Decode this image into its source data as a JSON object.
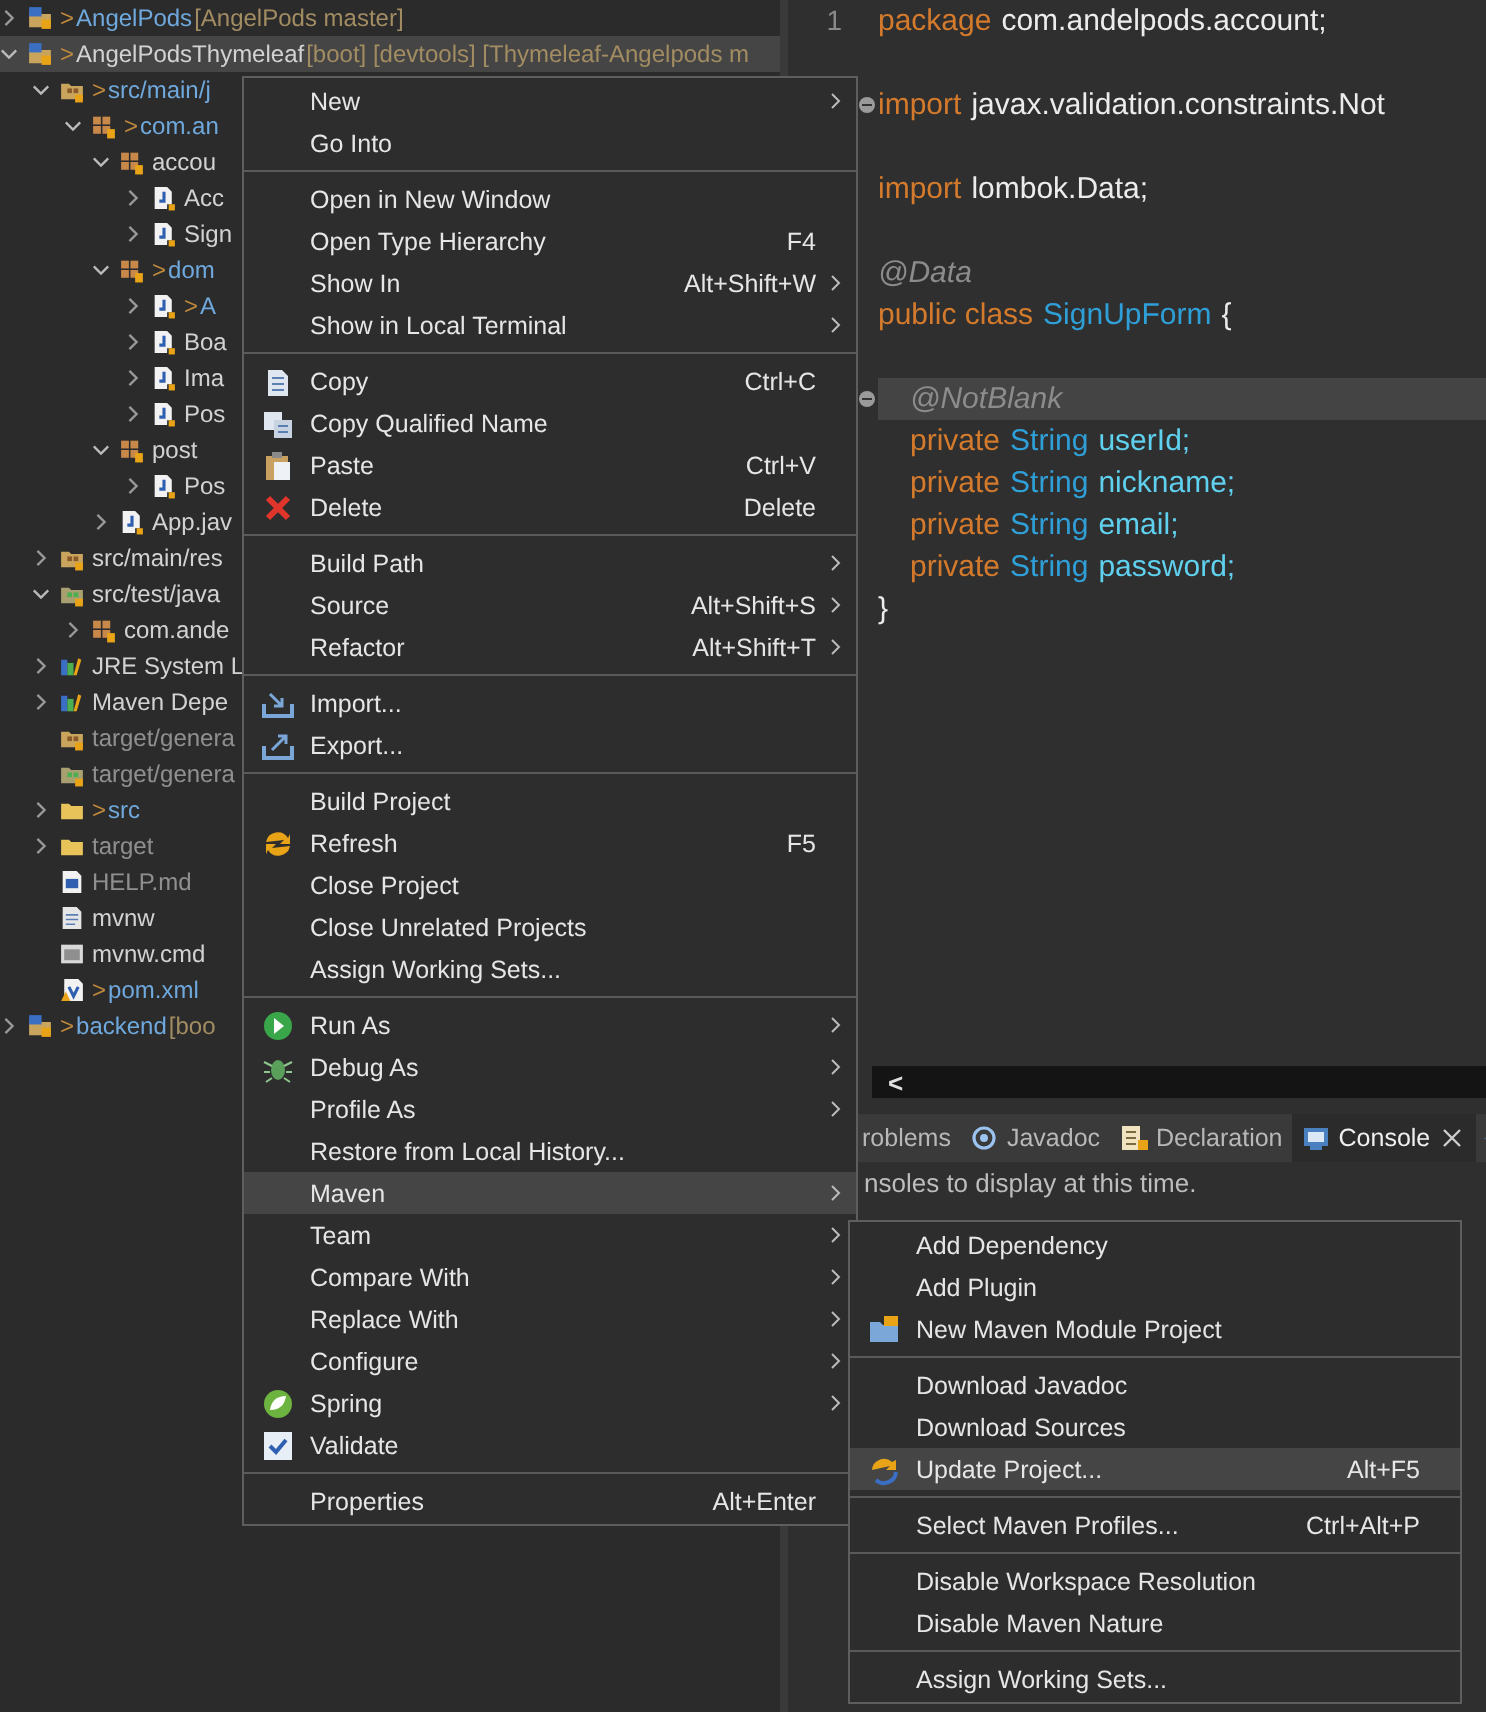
{
  "explorer": {
    "tree": [
      {
        "label": "AngelPods",
        "marker": ">",
        "deco": "[AngelPods master]",
        "kind": "project",
        "changed": true,
        "derived": false,
        "expandable": true,
        "expanded": false,
        "selected": false
      },
      {
        "label": "AngelPodsThymeleaf",
        "marker": ">",
        "deco": "[boot] [devtools] [Thymeleaf-Angelpods m",
        "kind": "project",
        "changed": false,
        "derived": false,
        "expandable": true,
        "expanded": true,
        "selected": true,
        "children": [
          {
            "label": "src/main/j",
            "marker": ">",
            "kind": "srcfolder",
            "changed": true,
            "derived": false,
            "expandable": true,
            "expanded": true,
            "selected": false,
            "children": [
              {
                "label": "com.an",
                "marker": ">",
                "kind": "package",
                "changed": true,
                "derived": false,
                "expandable": true,
                "expanded": true,
                "selected": false,
                "children": [
                  {
                    "label": "accou",
                    "kind": "package",
                    "changed": false,
                    "derived": false,
                    "expandable": true,
                    "expanded": true,
                    "selected": false,
                    "children": [
                      {
                        "label": "Acc",
                        "kind": "java",
                        "changed": false,
                        "derived": false,
                        "expandable": true,
                        "expanded": false,
                        "selected": false
                      },
                      {
                        "label": "Sign",
                        "kind": "java",
                        "changed": false,
                        "derived": false,
                        "expandable": true,
                        "expanded": false,
                        "selected": false
                      }
                    ]
                  },
                  {
                    "label": "dom",
                    "marker": ">",
                    "kind": "package",
                    "changed": true,
                    "derived": false,
                    "expandable": true,
                    "expanded": true,
                    "selected": false,
                    "children": [
                      {
                        "label": "A",
                        "marker": ">",
                        "kind": "java",
                        "changed": true,
                        "derived": false,
                        "expandable": true,
                        "expanded": false,
                        "selected": false
                      },
                      {
                        "label": "Boa",
                        "kind": "java",
                        "changed": false,
                        "derived": false,
                        "expandable": true,
                        "expanded": false,
                        "selected": false
                      },
                      {
                        "label": "Ima",
                        "kind": "java",
                        "changed": false,
                        "derived": false,
                        "expandable": true,
                        "expanded": false,
                        "selected": false
                      },
                      {
                        "label": "Pos",
                        "kind": "java",
                        "changed": false,
                        "derived": false,
                        "expandable": true,
                        "expanded": false,
                        "selected": false
                      }
                    ]
                  },
                  {
                    "label": "post",
                    "kind": "package",
                    "changed": false,
                    "derived": false,
                    "expandable": true,
                    "expanded": true,
                    "selected": false,
                    "children": [
                      {
                        "label": "Pos",
                        "kind": "java",
                        "changed": false,
                        "derived": false,
                        "expandable": true,
                        "expanded": false,
                        "selected": false
                      }
                    ]
                  },
                  {
                    "label": "App.jav",
                    "kind": "java",
                    "changed": false,
                    "derived": false,
                    "expandable": true,
                    "expanded": false,
                    "selected": false
                  }
                ]
              }
            ]
          },
          {
            "label": "src/main/res",
            "kind": "srcfolder",
            "changed": false,
            "derived": false,
            "expandable": true,
            "expanded": false,
            "selected": false
          },
          {
            "label": "src/test/java",
            "kind": "testfolder",
            "changed": false,
            "derived": false,
            "expandable": true,
            "expanded": true,
            "selected": false,
            "children": [
              {
                "label": "com.ande",
                "kind": "package",
                "changed": false,
                "derived": false,
                "expandable": true,
                "expanded": false,
                "selected": false
              }
            ]
          },
          {
            "label": "JRE System L",
            "kind": "library",
            "changed": false,
            "derived": false,
            "expandable": true,
            "expanded": false,
            "selected": false
          },
          {
            "label": "Maven Depe",
            "kind": "library",
            "changed": false,
            "derived": false,
            "expandable": true,
            "expanded": false,
            "selected": false
          },
          {
            "label": "target/genera",
            "kind": "srcfolder",
            "changed": false,
            "derived": true,
            "expandable": false,
            "selected": false
          },
          {
            "label": "target/genera",
            "kind": "testfolder",
            "changed": false,
            "derived": true,
            "expandable": false,
            "selected": false
          },
          {
            "label": "src",
            "marker": ">",
            "kind": "folder",
            "changed": true,
            "derived": false,
            "expandable": true,
            "expanded": false,
            "selected": false
          },
          {
            "label": "target",
            "kind": "folder",
            "changed": false,
            "derived": true,
            "expandable": true,
            "expanded": false,
            "selected": false
          },
          {
            "label": "HELP.md",
            "kind": "doc",
            "changed": false,
            "derived": true,
            "expandable": false,
            "selected": false
          },
          {
            "label": "mvnw",
            "kind": "text",
            "changed": false,
            "derived": false,
            "expandable": false,
            "selected": false
          },
          {
            "label": "mvnw.cmd",
            "kind": "cmd",
            "changed": false,
            "derived": false,
            "expandable": false,
            "selected": false
          },
          {
            "label": "pom.xml",
            "marker": ">",
            "kind": "xml",
            "changed": true,
            "derived": false,
            "expandable": false,
            "selected": false
          }
        ]
      },
      {
        "label": "backend",
        "marker": ">",
        "deco": "[boo",
        "kind": "project",
        "changed": true,
        "derived": false,
        "expandable": true,
        "expanded": false,
        "selected": false
      }
    ]
  },
  "editor": {
    "line_numbers": [
      "1"
    ],
    "lines": [
      {
        "kind": "code",
        "indented": false,
        "current": false,
        "fold": false,
        "tokens": [
          {
            "kind": "keyword",
            "text": "package"
          },
          {
            "kind": "plain",
            "text": "com.andelpods.account;"
          }
        ]
      },
      {
        "kind": "blank"
      },
      {
        "kind": "code",
        "indented": false,
        "current": false,
        "fold": true,
        "tokens": [
          {
            "kind": "keyword",
            "text": "import"
          },
          {
            "kind": "plain",
            "text": "javax.validation.constraints.Not"
          }
        ]
      },
      {
        "kind": "blank"
      },
      {
        "kind": "code",
        "indented": false,
        "current": false,
        "fold": false,
        "tokens": [
          {
            "kind": "keyword",
            "text": "import"
          },
          {
            "kind": "plain",
            "text": "lombok.Data;"
          }
        ]
      },
      {
        "kind": "blank"
      },
      {
        "kind": "code",
        "indented": false,
        "current": false,
        "fold": false,
        "tokens": [
          {
            "kind": "annotation",
            "text": "@Data"
          }
        ]
      },
      {
        "kind": "code",
        "indented": false,
        "current": false,
        "fold": false,
        "tokens": [
          {
            "kind": "keyword",
            "text": "public class"
          },
          {
            "kind": "type",
            "text": "SignUpForm"
          },
          {
            "kind": "plain",
            "text": "{"
          }
        ]
      },
      {
        "kind": "blank"
      },
      {
        "kind": "code",
        "indented": true,
        "current": true,
        "fold": true,
        "tokens": [
          {
            "kind": "annotation",
            "text": "@NotBlank"
          }
        ]
      },
      {
        "kind": "code",
        "indented": true,
        "current": false,
        "fold": false,
        "tokens": [
          {
            "kind": "keyword",
            "text": "private"
          },
          {
            "kind": "type",
            "text": "String"
          },
          {
            "kind": "field",
            "text": "userId;"
          }
        ]
      },
      {
        "kind": "code",
        "indented": true,
        "current": false,
        "fold": false,
        "tokens": [
          {
            "kind": "keyword",
            "text": "private"
          },
          {
            "kind": "type",
            "text": "String"
          },
          {
            "kind": "field",
            "text": "nickname;"
          }
        ]
      },
      {
        "kind": "code",
        "indented": true,
        "current": false,
        "fold": false,
        "tokens": [
          {
            "kind": "keyword",
            "text": "private"
          },
          {
            "kind": "type",
            "text": "String"
          },
          {
            "kind": "field",
            "text": "email;"
          }
        ]
      },
      {
        "kind": "code",
        "indented": true,
        "current": false,
        "fold": false,
        "tokens": [
          {
            "kind": "keyword",
            "text": "private"
          },
          {
            "kind": "type",
            "text": "String"
          },
          {
            "kind": "field",
            "text": "password;"
          }
        ]
      },
      {
        "kind": "code",
        "indented": false,
        "current": false,
        "fold": false,
        "tokens": [
          {
            "kind": "plain",
            "text": "}"
          }
        ]
      }
    ],
    "scroll_arrow": "<"
  },
  "bottom_panel": {
    "tabs": [
      {
        "label": "roblems",
        "kind": "plain",
        "selected": false,
        "closable": false
      },
      {
        "label": "Javadoc",
        "kind": "javadoc",
        "selected": false,
        "closable": false
      },
      {
        "label": "Declaration",
        "kind": "declaration",
        "selected": false,
        "closable": false
      },
      {
        "label": "Console",
        "kind": "console",
        "selected": true,
        "closable": true
      }
    ],
    "message": "nsoles to display at this time."
  },
  "context_menu": {
    "items": [
      {
        "kind": "plain",
        "label": "New",
        "submenu": true,
        "selected": false
      },
      {
        "kind": "plain",
        "label": "Go Into",
        "submenu": false,
        "selected": false
      },
      {
        "kind": "separator"
      },
      {
        "kind": "plain",
        "label": "Open in New Window",
        "submenu": false,
        "selected": false
      },
      {
        "kind": "plain",
        "label": "Open Type Hierarchy",
        "shortcut": "F4",
        "submenu": false,
        "selected": false
      },
      {
        "kind": "plain",
        "label": "Show In",
        "shortcut": "Alt+Shift+W",
        "submenu": true,
        "selected": false
      },
      {
        "kind": "plain",
        "label": "Show in Local Terminal",
        "submenu": true,
        "selected": false
      },
      {
        "kind": "separator"
      },
      {
        "kind": "copy",
        "label": "Copy",
        "shortcut": "Ctrl+C",
        "submenu": false,
        "selected": false
      },
      {
        "kind": "copyname",
        "label": "Copy Qualified Name",
        "submenu": false,
        "selected": false
      },
      {
        "kind": "paste",
        "label": "Paste",
        "shortcut": "Ctrl+V",
        "submenu": false,
        "selected": false
      },
      {
        "kind": "delete",
        "label": "Delete",
        "shortcut": "Delete",
        "submenu": false,
        "selected": false
      },
      {
        "kind": "separator"
      },
      {
        "kind": "plain",
        "label": "Build Path",
        "submenu": true,
        "selected": false
      },
      {
        "kind": "plain",
        "label": "Source",
        "shortcut": "Alt+Shift+S",
        "submenu": true,
        "selected": false
      },
      {
        "kind": "plain",
        "label": "Refactor",
        "shortcut": "Alt+Shift+T",
        "submenu": true,
        "selected": false
      },
      {
        "kind": "separator"
      },
      {
        "kind": "import",
        "label": "Import...",
        "submenu": false,
        "selected": false
      },
      {
        "kind": "export",
        "label": "Export...",
        "submenu": false,
        "selected": false
      },
      {
        "kind": "separator"
      },
      {
        "kind": "plain",
        "label": "Build Project",
        "submenu": false,
        "selected": false
      },
      {
        "kind": "refresh",
        "label": "Refresh",
        "shortcut": "F5",
        "submenu": false,
        "selected": false
      },
      {
        "kind": "plain",
        "label": "Close Project",
        "submenu": false,
        "selected": false
      },
      {
        "kind": "plain",
        "label": "Close Unrelated Projects",
        "submenu": false,
        "selected": false
      },
      {
        "kind": "plain",
        "label": "Assign Working Sets...",
        "submenu": false,
        "selected": false
      },
      {
        "kind": "separator"
      },
      {
        "kind": "run",
        "label": "Run As",
        "submenu": true,
        "selected": false
      },
      {
        "kind": "debug",
        "label": "Debug As",
        "submenu": true,
        "selected": false
      },
      {
        "kind": "plain",
        "label": "Profile As",
        "submenu": true,
        "selected": false
      },
      {
        "kind": "plain",
        "label": "Restore from Local History...",
        "submenu": false,
        "selected": false
      },
      {
        "kind": "plain",
        "label": "Maven",
        "submenu": true,
        "selected": true
      },
      {
        "kind": "plain",
        "label": "Team",
        "submenu": true,
        "selected": false
      },
      {
        "kind": "plain",
        "label": "Compare With",
        "submenu": true,
        "selected": false
      },
      {
        "kind": "plain",
        "label": "Replace With",
        "submenu": true,
        "selected": false
      },
      {
        "kind": "plain",
        "label": "Configure",
        "submenu": true,
        "selected": false
      },
      {
        "kind": "spring",
        "label": "Spring",
        "submenu": true,
        "selected": false
      },
      {
        "kind": "validate",
        "label": "Validate",
        "submenu": false,
        "selected": false
      },
      {
        "kind": "separator"
      },
      {
        "kind": "plain",
        "label": "Properties",
        "shortcut": "Alt+Enter",
        "submenu": false,
        "selected": false
      }
    ]
  },
  "submenu": {
    "items": [
      {
        "kind": "plain",
        "label": "Add Dependency",
        "submenu": false,
        "selected": false
      },
      {
        "kind": "plain",
        "label": "Add Plugin",
        "submenu": false,
        "selected": false
      },
      {
        "kind": "module",
        "label": "New Maven Module Project",
        "submenu": false,
        "selected": false
      },
      {
        "kind": "separator"
      },
      {
        "kind": "plain",
        "label": "Download Javadoc",
        "submenu": false,
        "selected": false
      },
      {
        "kind": "plain",
        "label": "Download Sources",
        "submenu": false,
        "selected": false
      },
      {
        "kind": "update",
        "label": "Update Project...",
        "shortcut": "Alt+F5",
        "submenu": false,
        "selected": true
      },
      {
        "kind": "separator"
      },
      {
        "kind": "plain",
        "label": "Select Maven Profiles...",
        "shortcut": "Ctrl+Alt+P",
        "submenu": false,
        "selected": false
      },
      {
        "kind": "separator"
      },
      {
        "kind": "plain",
        "label": "Disable Workspace Resolution",
        "submenu": false,
        "selected": false
      },
      {
        "kind": "plain",
        "label": "Disable Maven Nature",
        "submenu": false,
        "selected": false
      },
      {
        "kind": "separator"
      },
      {
        "kind": "plain",
        "label": "Assign Working Sets...",
        "submenu": false,
        "selected": false
      }
    ]
  }
}
